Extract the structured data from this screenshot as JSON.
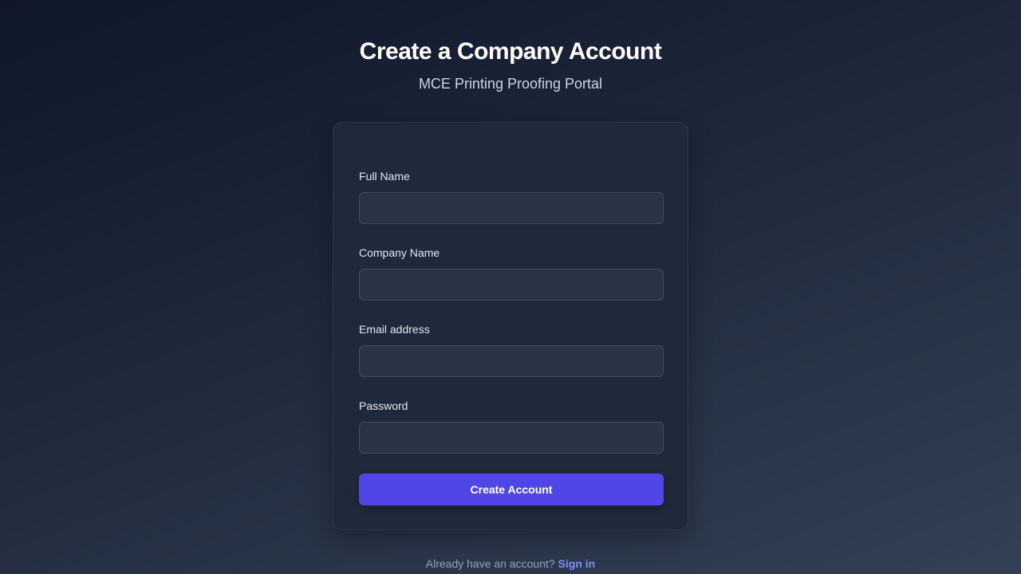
{
  "header": {
    "title": "Create a Company Account",
    "subtitle": "MCE Printing Proofing Portal"
  },
  "form": {
    "fields": [
      {
        "label": "Full Name",
        "value": "",
        "placeholder": ""
      },
      {
        "label": "Company Name",
        "value": "",
        "placeholder": ""
      },
      {
        "label": "Email address",
        "value": "",
        "placeholder": ""
      },
      {
        "label": "Password",
        "value": "",
        "placeholder": ""
      }
    ],
    "submit_label": "Create Account"
  },
  "footer": {
    "prompt": "Already have an account?",
    "link": "Sign in"
  }
}
